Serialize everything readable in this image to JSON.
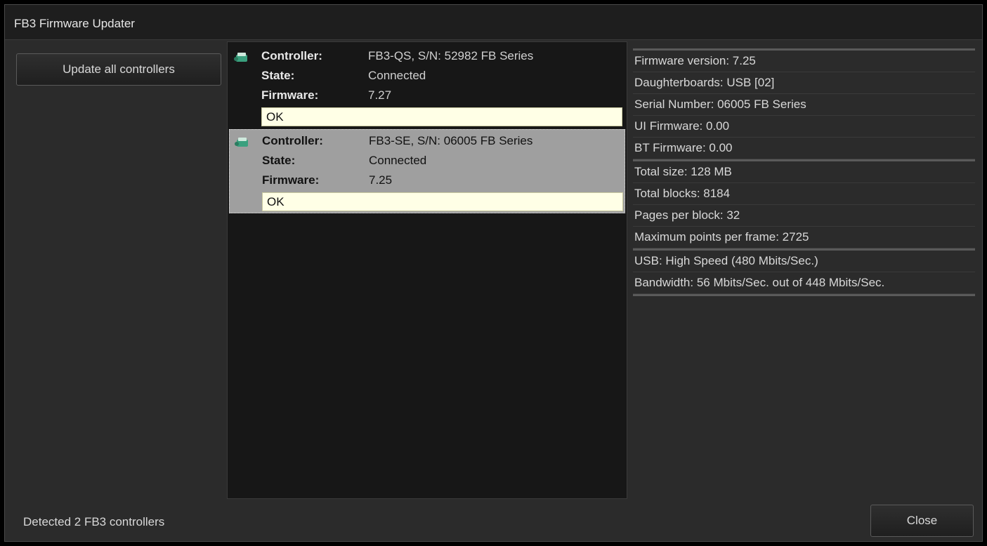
{
  "window": {
    "title": "FB3 Firmware Updater"
  },
  "actions": {
    "update_all_label": "Update all controllers",
    "close_label": "Close"
  },
  "status": {
    "text": "Detected 2 FB3 controllers"
  },
  "labels": {
    "controller": "Controller:",
    "state": "State:",
    "firmware": "Firmware:"
  },
  "controllers": [
    {
      "controller": "FB3-QS, S/N: 52982 FB Series",
      "state": "Connected",
      "firmware": "7.27",
      "status": "OK",
      "selected": false
    },
    {
      "controller": "FB3-SE, S/N: 06005 FB Series",
      "state": "Connected",
      "firmware": "7.25",
      "status": "OK",
      "selected": true
    }
  ],
  "details": {
    "firmware_version": "Firmware version: 7.25",
    "daughterboards": "Daughterboards: USB [02]",
    "serial_number": "Serial Number: 06005 FB Series",
    "ui_firmware": "UI Firmware: 0.00",
    "bt_firmware": "BT Firmware: 0.00",
    "total_size": "Total size: 128 MB",
    "total_blocks": "Total blocks: 8184",
    "pages_per_block": "Pages per block: 32",
    "max_points": "Maximum points per frame: 2725",
    "usb": "USB: High Speed (480 Mbits/Sec.)",
    "bandwidth": "Bandwidth: 56 Mbits/Sec. out of 448 Mbits/Sec."
  },
  "colors": {
    "background": "#2b2b2b",
    "selected_row": "#9f9f9f",
    "status_bar": "#ffffe6",
    "icon": "#2e8b6e"
  }
}
